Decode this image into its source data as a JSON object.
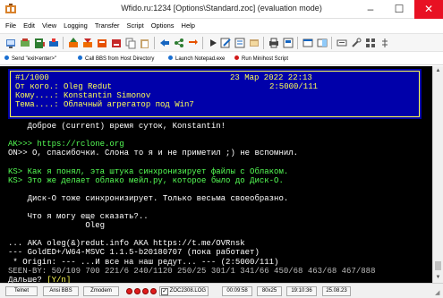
{
  "window": {
    "title": "Wfido.ru:1234 [Options\\Standard.zoc] (evaluation mode)",
    "minimize": "–",
    "maximize": "☐",
    "close": "✕"
  },
  "menu": [
    "File",
    "Edit",
    "View",
    "Logging",
    "Transfer",
    "Script",
    "Options",
    "Help"
  ],
  "quickbar": [
    {
      "label": "Send \"exit<enter>\"",
      "color": "#1a6fd1"
    },
    {
      "label": "Call BBS from Host Directory",
      "color": "#1a6fd1"
    },
    {
      "label": "Launch Notepad.exe",
      "color": "#1a6fd1"
    },
    {
      "label": "Run Minihost Script",
      "color": "#d11a1a"
    }
  ],
  "terminal": {
    "header": {
      "msgno": "#1/1000",
      "date": "23 Мар 2022 22:13",
      "from": "От кого.: Oleg Redut",
      "from_addr": "2:5000/111",
      "to": "Кому....: Konstantin Simonov",
      "subj": "Тема....: Облачный агрегатор под Win7"
    },
    "lines": [
      {
        "text": "    Доброе (current) время суток, Konstantin!",
        "color": "white"
      },
      {
        "text": "",
        "color": "white"
      },
      {
        "text": "AK>>> https://rclone.org",
        "color": "green"
      },
      {
        "text": "ON>> О, спасибочки. Слона то я и не приметил ;) не вспомнил.",
        "color": "white"
      },
      {
        "text": "",
        "color": "white"
      },
      {
        "text": "KS> Как я понял, эта штука синхронизирует файлы с Облаком.",
        "color": "green"
      },
      {
        "text": "KS> Это же делает облако мейл.ру, которое было до Диск-О.",
        "color": "green"
      },
      {
        "text": "",
        "color": "white"
      },
      {
        "text": "    Диск-О тоже синхронизирует. Только весьма своеобразно.",
        "color": "white"
      },
      {
        "text": "",
        "color": "white"
      },
      {
        "text": "    Что я могу еще сказать?..",
        "color": "white"
      },
      {
        "text": "                Oleg",
        "color": "white"
      },
      {
        "text": "",
        "color": "white"
      },
      {
        "text": "... AKA oleg(&)redut.info AKA https://t.me/OVRnsk",
        "color": "white"
      },
      {
        "text": "--- GoldED+/W64-MSVC 1.1.5-b20180707 (пока работает)",
        "color": "white"
      },
      {
        "text": " * Origin: --- ...И все на наш редут... --- (2:5000/111)",
        "color": "white"
      },
      {
        "text": "SEEN-BY: 50/109 700 221/6 240/1120 250/25 301/1 341/66 450/68 463/68 467/888",
        "color": "gray"
      },
      {
        "text": "Дальше? [Y/n]",
        "color": "white",
        "highlight": "[Y/n]"
      }
    ]
  },
  "status": {
    "protocol": "Telnet",
    "emulation": "Ansi BBS",
    "transfer": "Zmodem",
    "logfile": "ZOC2308.LOG",
    "elapsed": "00:09:58",
    "size": "80x25",
    "time": "19:10:36",
    "date": "25.08.23"
  },
  "colors": {
    "terminal_bg": "#000000",
    "header_bg": "#0000aa",
    "header_fg": "#ffff55",
    "quote_green": "#00aa00",
    "titlebar_close": "#e81123"
  }
}
